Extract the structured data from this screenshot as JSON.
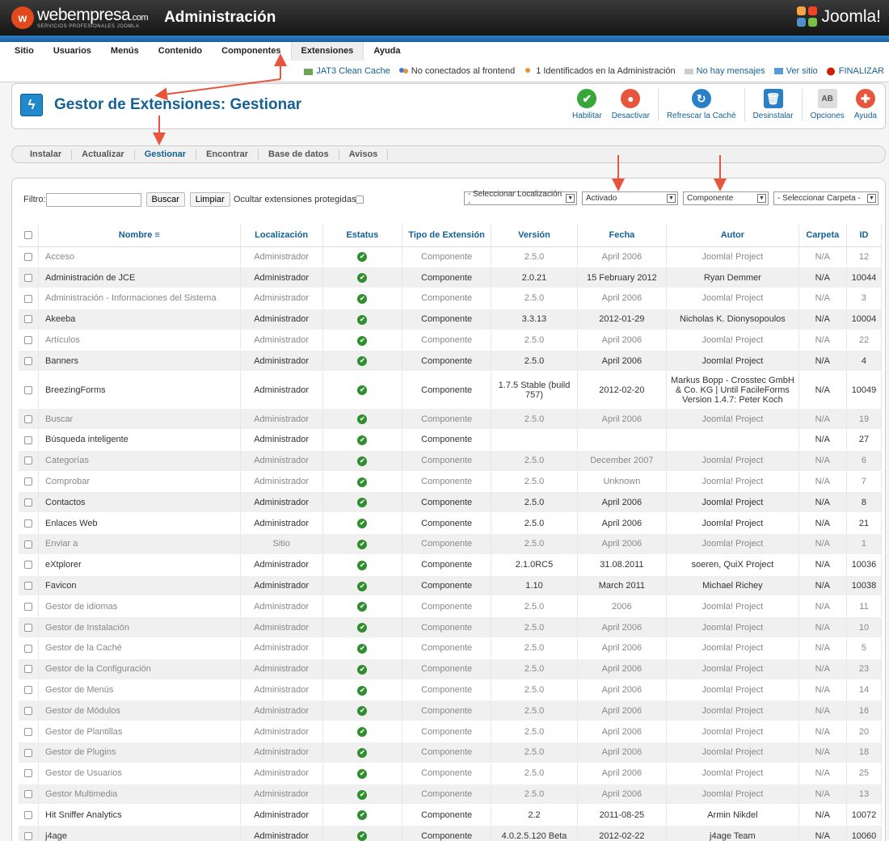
{
  "header": {
    "brand_name": "webempresa",
    "brand_suffix": ".com",
    "brand_tagline": "SERVICIOS PROFESIONALES JOOMLA",
    "title": "Administración",
    "joomla_label": "Joomla!"
  },
  "menu": [
    "Sitio",
    "Usuarios",
    "Menús",
    "Contenido",
    "Componentes",
    "Extensiones",
    "Ayuda"
  ],
  "status": {
    "cache": "JAT3 Clean Cache",
    "frontend": "No conectados al frontend",
    "admin": "1 Identificados en la Administración",
    "messages": "No hay mensajes",
    "view_site": "Ver sitio",
    "logout": "FINALIZAR"
  },
  "page_title": "Gestor de Extensiones: Gestionar",
  "toolbar": {
    "enable": "Habilitar",
    "disable": "Desactivar",
    "refresh": "Refrescar la Caché",
    "uninstall": "Desinstalar",
    "options": "Opciones",
    "help": "Ayuda"
  },
  "subtabs": [
    "Instalar",
    "Actualizar",
    "Gestionar",
    "Encontrar",
    "Base de datos",
    "Avisos"
  ],
  "filter": {
    "label": "Filtro:",
    "search_button": "Buscar",
    "clear_button": "Limpiar",
    "hide_protected": "Ocultar extensiones protegidas",
    "location": "- Seleccionar Localización -",
    "state": "Activado",
    "type": "Componente",
    "folder": "- Seleccionar Carpeta -"
  },
  "table": {
    "headers": [
      "Nombre",
      "Localización",
      "Estatus",
      "Tipo de Extensión",
      "Versión",
      "Fecha",
      "Autor",
      "Carpeta",
      "ID"
    ],
    "rows": [
      {
        "name": "Acceso",
        "loc": "Administrador",
        "type": "Componente",
        "ver": "2.5.0",
        "date": "April 2006",
        "author": "Joomla! Project",
        "folder": "N/A",
        "id": "12",
        "dim": true
      },
      {
        "name": "Administración de JCE",
        "loc": "Administrador",
        "type": "Componente",
        "ver": "2.0.21",
        "date": "15 February 2012",
        "author": "Ryan Demmer",
        "folder": "N/A",
        "id": "10044",
        "dim": false
      },
      {
        "name": "Administración - Informaciones del Sistema",
        "loc": "Administrador",
        "type": "Componente",
        "ver": "2.5.0",
        "date": "April 2006",
        "author": "Joomla! Project",
        "folder": "N/A",
        "id": "3",
        "dim": true
      },
      {
        "name": "Akeeba",
        "loc": "Administrador",
        "type": "Componente",
        "ver": "3.3.13",
        "date": "2012-01-29",
        "author": "Nicholas K. Dionysopoulos",
        "folder": "N/A",
        "id": "10004",
        "dim": false
      },
      {
        "name": "Artículos",
        "loc": "Administrador",
        "type": "Componente",
        "ver": "2.5.0",
        "date": "April 2006",
        "author": "Joomla! Project",
        "folder": "N/A",
        "id": "22",
        "dim": true
      },
      {
        "name": "Banners",
        "loc": "Administrador",
        "type": "Componente",
        "ver": "2.5.0",
        "date": "April 2006",
        "author": "Joomla! Project",
        "folder": "N/A",
        "id": "4",
        "dim": false
      },
      {
        "name": "BreezingForms",
        "loc": "Administrador",
        "type": "Componente",
        "ver": "1.7.5 Stable (build 757)",
        "date": "2012-02-20",
        "author": "Markus Bopp - Crosstec GmbH & Co. KG | Until FacileForms Version 1.4.7: Peter Koch",
        "folder": "N/A",
        "id": "10049",
        "dim": false,
        "tall": true
      },
      {
        "name": "Buscar",
        "loc": "Administrador",
        "type": "Componente",
        "ver": "2.5.0",
        "date": "April 2006",
        "author": "Joomla! Project",
        "folder": "N/A",
        "id": "19",
        "dim": true
      },
      {
        "name": "Búsqueda inteligente",
        "loc": "Administrador",
        "type": "Componente",
        "ver": "",
        "date": "",
        "author": "",
        "folder": "N/A",
        "id": "27",
        "dim": false
      },
      {
        "name": "Categorías",
        "loc": "Administrador",
        "type": "Componente",
        "ver": "2.5.0",
        "date": "December 2007",
        "author": "Joomla! Project",
        "folder": "N/A",
        "id": "6",
        "dim": true
      },
      {
        "name": "Comprobar",
        "loc": "Administrador",
        "type": "Componente",
        "ver": "2.5.0",
        "date": "Unknown",
        "author": "Joomla! Project",
        "folder": "N/A",
        "id": "7",
        "dim": true
      },
      {
        "name": "Contactos",
        "loc": "Administrador",
        "type": "Componente",
        "ver": "2.5.0",
        "date": "April 2006",
        "author": "Joomla! Project",
        "folder": "N/A",
        "id": "8",
        "dim": false
      },
      {
        "name": "Enlaces Web",
        "loc": "Administrador",
        "type": "Componente",
        "ver": "2.5.0",
        "date": "April 2006",
        "author": "Joomla! Project",
        "folder": "N/A",
        "id": "21",
        "dim": false
      },
      {
        "name": "Enviar a",
        "loc": "Sitio",
        "type": "Componente",
        "ver": "2.5.0",
        "date": "April 2006",
        "author": "Joomla! Project",
        "folder": "N/A",
        "id": "1",
        "dim": true
      },
      {
        "name": "eXtplorer",
        "loc": "Administrador",
        "type": "Componente",
        "ver": "2.1.0RC5",
        "date": "31.08.2011",
        "author": "soeren, QuiX Project",
        "folder": "N/A",
        "id": "10036",
        "dim": false
      },
      {
        "name": "Favicon",
        "loc": "Administrador",
        "type": "Componente",
        "ver": "1.10",
        "date": "March 2011",
        "author": "Michael Richey",
        "folder": "N/A",
        "id": "10038",
        "dim": false
      },
      {
        "name": "Gestor de idiomas",
        "loc": "Administrador",
        "type": "Componente",
        "ver": "2.5.0",
        "date": "2006",
        "author": "Joomla! Project",
        "folder": "N/A",
        "id": "11",
        "dim": true
      },
      {
        "name": "Gestor de Instalación",
        "loc": "Administrador",
        "type": "Componente",
        "ver": "2.5.0",
        "date": "April 2006",
        "author": "Joomla! Project",
        "folder": "N/A",
        "id": "10",
        "dim": true
      },
      {
        "name": "Gestor de la Caché",
        "loc": "Administrador",
        "type": "Componente",
        "ver": "2.5.0",
        "date": "April 2006",
        "author": "Joomla! Project",
        "folder": "N/A",
        "id": "5",
        "dim": true
      },
      {
        "name": "Gestor de la Configuración",
        "loc": "Administrador",
        "type": "Componente",
        "ver": "2.5.0",
        "date": "April 2006",
        "author": "Joomla! Project",
        "folder": "N/A",
        "id": "23",
        "dim": true
      },
      {
        "name": "Gestor de Menús",
        "loc": "Administrador",
        "type": "Componente",
        "ver": "2.5.0",
        "date": "April 2006",
        "author": "Joomla! Project",
        "folder": "N/A",
        "id": "14",
        "dim": true
      },
      {
        "name": "Gestor de Módulos",
        "loc": "Administrador",
        "type": "Componente",
        "ver": "2.5.0",
        "date": "April 2006",
        "author": "Joomla! Project",
        "folder": "N/A",
        "id": "16",
        "dim": true
      },
      {
        "name": "Gestor de Plantillas",
        "loc": "Administrador",
        "type": "Componente",
        "ver": "2.5.0",
        "date": "April 2006",
        "author": "Joomla! Project",
        "folder": "N/A",
        "id": "20",
        "dim": true
      },
      {
        "name": "Gestor de Plugins",
        "loc": "Administrador",
        "type": "Componente",
        "ver": "2.5.0",
        "date": "April 2006",
        "author": "Joomla! Project",
        "folder": "N/A",
        "id": "18",
        "dim": true
      },
      {
        "name": "Gestor de Usuarios",
        "loc": "Administrador",
        "type": "Componente",
        "ver": "2.5.0",
        "date": "April 2006",
        "author": "Joomla! Project",
        "folder": "N/A",
        "id": "25",
        "dim": true
      },
      {
        "name": "Gestor Multimedia",
        "loc": "Administrador",
        "type": "Componente",
        "ver": "2.5.0",
        "date": "April 2006",
        "author": "Joomla! Project",
        "folder": "N/A",
        "id": "13",
        "dim": true
      },
      {
        "name": "Hit Sniffer Analytics",
        "loc": "Administrador",
        "type": "Componente",
        "ver": "2.2",
        "date": "2011-08-25",
        "author": "Armin Nikdel",
        "folder": "N/A",
        "id": "10072",
        "dim": false
      },
      {
        "name": "j4age",
        "loc": "Administrador",
        "type": "Componente",
        "ver": "4.0.2.5.120 Beta",
        "date": "2012-02-22",
        "author": "j4age Team",
        "folder": "N/A",
        "id": "10060",
        "dim": false
      }
    ]
  },
  "colors": {
    "link": "#146295",
    "header_bg": "#1a1a1a",
    "accent_blue": "#1f89cc",
    "ok_green": "#2f8f2f",
    "arrow_red": "#e8553d"
  }
}
